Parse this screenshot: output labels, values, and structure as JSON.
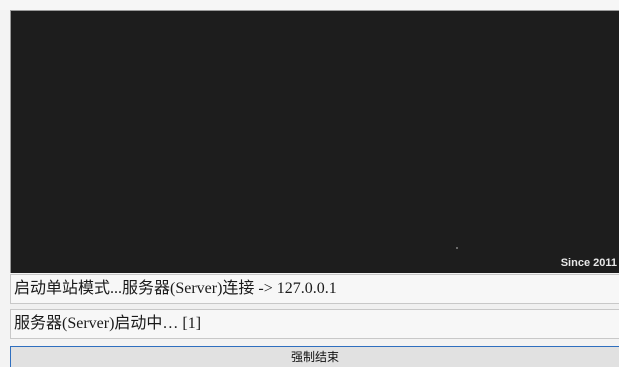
{
  "display": {
    "since_label": "Since 2011"
  },
  "status": {
    "line1": "启动单站模式...服务器(Server)连接 -> 127.0.0.1",
    "line2": "服务器(Server)启动中… [1]"
  },
  "actions": {
    "force_quit_label": "强制结束"
  },
  "colors": {
    "display_background": "#1d1d1d",
    "button_border": "#2f6fbf"
  }
}
